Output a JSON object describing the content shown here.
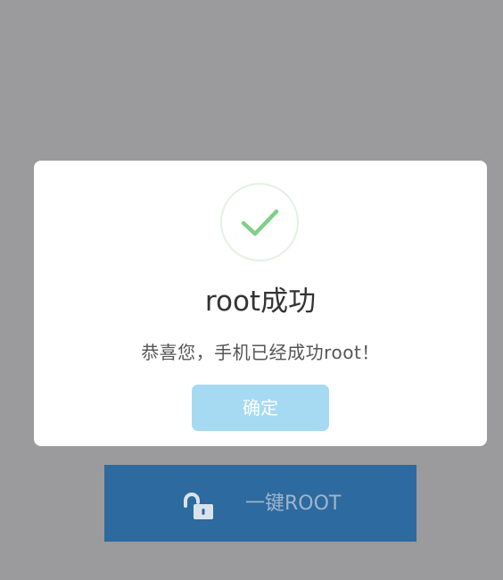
{
  "dialog": {
    "title": "root成功",
    "message": "恭喜您，手机已经成功root！",
    "confirm_label": "确定",
    "icon": "check-icon"
  },
  "background_button": {
    "label": "一键ROOT",
    "icon": "unlock-icon"
  },
  "colors": {
    "check": "#7fcf86",
    "confirm_button": "#a6daf3",
    "root_button": "#2d6a9f",
    "backdrop": "#9b9a9c"
  }
}
